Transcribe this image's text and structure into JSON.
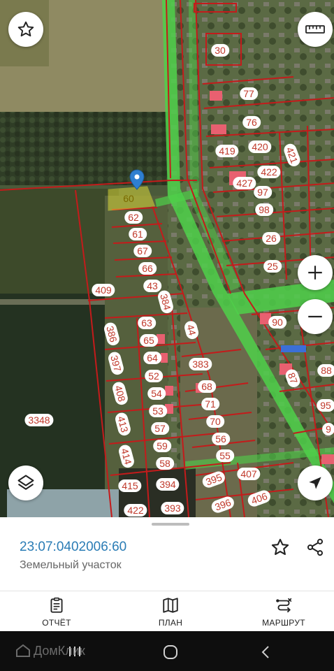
{
  "map": {
    "selected_plot": "60",
    "plots": [
      {
        "label": "30"
      },
      {
        "label": "77"
      },
      {
        "label": "76"
      },
      {
        "label": "419"
      },
      {
        "label": "420"
      },
      {
        "label": "421"
      },
      {
        "label": "422"
      },
      {
        "label": "427"
      },
      {
        "label": "97"
      },
      {
        "label": "98"
      },
      {
        "label": "26"
      },
      {
        "label": "25"
      },
      {
        "label": "62"
      },
      {
        "label": "61"
      },
      {
        "label": "67"
      },
      {
        "label": "66"
      },
      {
        "label": "43"
      },
      {
        "label": "409"
      },
      {
        "label": "384"
      },
      {
        "label": "63"
      },
      {
        "label": "44"
      },
      {
        "label": "386"
      },
      {
        "label": "65"
      },
      {
        "label": "397"
      },
      {
        "label": "64"
      },
      {
        "label": "383"
      },
      {
        "label": "52"
      },
      {
        "label": "408"
      },
      {
        "label": "54"
      },
      {
        "label": "68"
      },
      {
        "label": "53"
      },
      {
        "label": "71"
      },
      {
        "label": "3348"
      },
      {
        "label": "413"
      },
      {
        "label": "57"
      },
      {
        "label": "70"
      },
      {
        "label": "59"
      },
      {
        "label": "56"
      },
      {
        "label": "414"
      },
      {
        "label": "58"
      },
      {
        "label": "55"
      },
      {
        "label": "395"
      },
      {
        "label": "407"
      },
      {
        "label": "415"
      },
      {
        "label": "394"
      },
      {
        "label": "396"
      },
      {
        "label": "406"
      },
      {
        "label": "422"
      },
      {
        "label": "393"
      },
      {
        "label": "90"
      },
      {
        "label": "87"
      },
      {
        "label": "88"
      },
      {
        "label": "95"
      },
      {
        "label": "9"
      }
    ],
    "colors": {
      "boundary": "#c41b1b",
      "road": "#4fd04a",
      "selected": "#f7f23a",
      "pin": "#2f7fd0"
    }
  },
  "controls": {
    "favorite_icon": "star-icon",
    "ruler_icon": "ruler-icon",
    "zoom_in_icon": "plus-icon",
    "zoom_out_icon": "minus-icon",
    "layers_icon": "layers-icon",
    "locate_icon": "navigation-arrow-icon"
  },
  "sheet": {
    "cadastral_number": "23:07:0402006:60",
    "plot_type": "Земельный участок",
    "favorite_icon": "star-outline-icon",
    "share_icon": "share-icon"
  },
  "tabs": [
    {
      "label": "ОТЧЁТ",
      "icon": "report-icon"
    },
    {
      "label": "ПЛАН",
      "icon": "map-icon"
    },
    {
      "label": "МАРШРУТ",
      "icon": "route-icon"
    }
  ],
  "watermark": "ДомКлик",
  "system_nav": {
    "icons": [
      "recent-apps-icon",
      "home-icon",
      "back-icon"
    ]
  }
}
